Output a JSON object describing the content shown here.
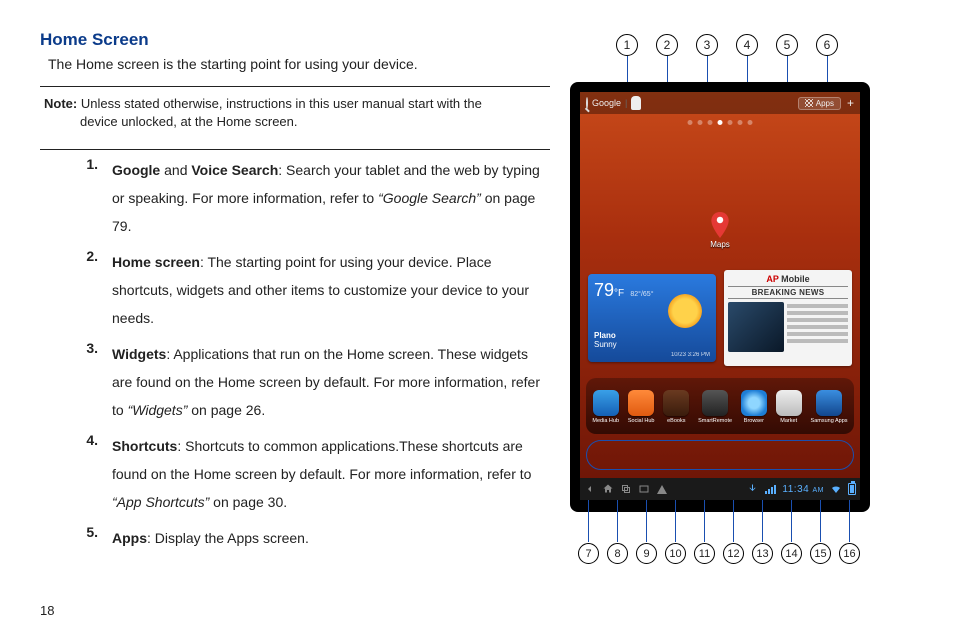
{
  "heading": "Home Screen",
  "intro": "The Home screen is the starting point for using your device.",
  "note_label": "Note:",
  "note_line1_rest": " Unless stated otherwise, instructions in this user manual start with the",
  "note_line2": "device unlocked, at the Home screen.",
  "items": [
    {
      "num": "1.",
      "b1": "Google",
      "mid1": " and ",
      "b2": "Voice Search",
      "rest1": ": Search your tablet and the web by typing or speaking. For more information, refer to ",
      "ital": "“Google Search”",
      "rest2": "  on page 79."
    },
    {
      "num": "2.",
      "b1": "Home screen",
      "rest1": ": The starting point for using your device. Place shortcuts, widgets and other items to customize your device to your needs."
    },
    {
      "num": "3.",
      "b1": "Widgets",
      "rest1": ": Applications that run on the Home screen. These widgets are found on the Home screen by default. For more information, refer to ",
      "ital": "“Widgets”",
      "rest2": "  on page 26."
    },
    {
      "num": "4.",
      "b1": "Shortcuts",
      "rest1": ": Shortcuts to common applications.These shortcuts are found on the Home screen by default. For more information, refer to ",
      "ital": "“App Shortcuts”",
      "rest2": "  on page 30."
    },
    {
      "num": "5.",
      "b1": "Apps",
      "rest1": ": Display the Apps screen."
    }
  ],
  "page_number": "18",
  "callouts_top": [
    "1",
    "2",
    "3",
    "4",
    "5",
    "6"
  ],
  "callouts_bottom": [
    "7",
    "8",
    "9",
    "10",
    "11",
    "12",
    "13",
    "14",
    "15",
    "16"
  ],
  "tablet": {
    "search_label": "Google",
    "apps_label": "Apps",
    "plus": "+",
    "pin_label": "Maps",
    "weather": {
      "temp": "79",
      "unit": "°F",
      "hi_lo": "82°/65°",
      "city": "Plano",
      "cond": "Sunny",
      "time": "10/23 3:26 PM"
    },
    "news": {
      "brand_ap": "AP",
      "brand_rest": " Mobile",
      "headline": "BREAKING NEWS"
    },
    "dock": [
      "Media Hub",
      "Social Hub",
      "eBooks",
      "SmartRemote",
      "Browser",
      "Market",
      "Samsung Apps"
    ],
    "clock": "11:34",
    "ampm": "AM"
  }
}
